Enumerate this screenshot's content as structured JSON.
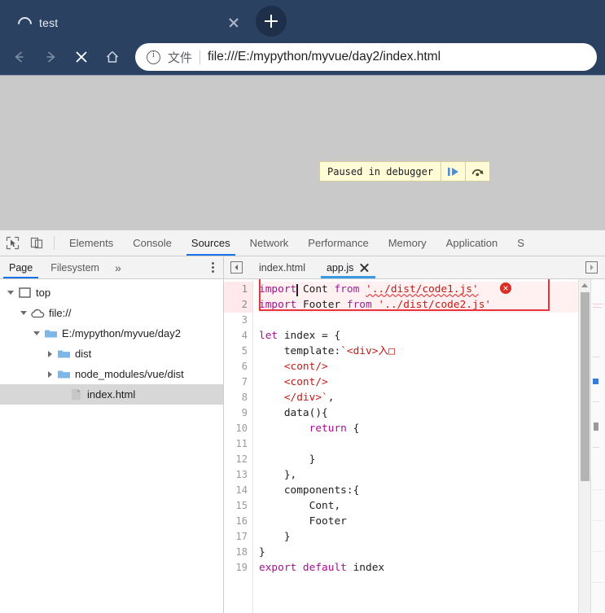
{
  "browser": {
    "tab": {
      "title": "test",
      "favicon": "loading-spinner-icon",
      "close_icon": "close-icon"
    },
    "new_tab_icon": "plus-icon",
    "nav": {
      "back_icon": "arrow-left-icon",
      "forward_icon": "arrow-right-icon",
      "stop_icon": "close-icon",
      "home_icon": "home-icon"
    },
    "omnibox": {
      "info_icon": "info-circle-icon",
      "scheme_label": "文件",
      "url": "file:///E:/mypython/myvue/day2/index.html"
    },
    "chrome_color": "#2b4162"
  },
  "viewport": {
    "background": "#c9c9c9",
    "paused_banner": {
      "label": "Paused in debugger",
      "resume_icon": "resume-script-icon",
      "step_over_icon": "step-over-icon",
      "background": "#fffbd7",
      "border": "#d4cf9a"
    }
  },
  "devtools": {
    "left_icons": [
      {
        "name": "inspect-element-icon"
      },
      {
        "name": "device-toolbar-icon"
      }
    ],
    "tabs": [
      {
        "label": "Elements",
        "active": false
      },
      {
        "label": "Console",
        "active": false
      },
      {
        "label": "Sources",
        "active": true
      },
      {
        "label": "Network",
        "active": false
      },
      {
        "label": "Performance",
        "active": false
      },
      {
        "label": "Memory",
        "active": false
      },
      {
        "label": "Application",
        "active": false
      },
      {
        "label": "S",
        "active": false
      }
    ],
    "active_tab_accent": "#1a73e8",
    "navigator": {
      "tabs": [
        {
          "label": "Page",
          "active": true
        },
        {
          "label": "Filesystem",
          "active": false
        }
      ],
      "more_tabs_icon": "chevron-double-right-icon",
      "more_options_icon": "kebab-menu-icon",
      "tree": [
        {
          "depth": 0,
          "twisty": "expanded",
          "icon": "frame-icon",
          "label": "top",
          "selected": false
        },
        {
          "depth": 1,
          "twisty": "expanded",
          "icon": "cloud-icon",
          "label": "file://",
          "selected": false
        },
        {
          "depth": 2,
          "twisty": "expanded",
          "icon": "folder-icon",
          "label": "E:/mypython/myvue/day2",
          "selected": false
        },
        {
          "depth": 3,
          "twisty": "collapsed",
          "icon": "folder-icon",
          "label": "dist",
          "selected": false
        },
        {
          "depth": 3,
          "twisty": "collapsed",
          "icon": "folder-icon",
          "label": "node_modules/vue/dist",
          "selected": false
        },
        {
          "depth": 3,
          "twisty": "none",
          "icon": "file-icon",
          "label": "index.html",
          "selected": true
        }
      ]
    },
    "editor": {
      "back_icon": "panel-collapse-icon",
      "forward_icon": "panel-expand-icon",
      "tabs": [
        {
          "label": "index.html",
          "active": false,
          "closable": false
        },
        {
          "label": "app.js",
          "active": true,
          "closable": true
        }
      ],
      "active_tab_accent": "#3a9ae0",
      "close_icon": "close-icon",
      "error_badge_icon": "error-circle-icon",
      "annotation_box_color": "#e8343c",
      "scrollbar": {
        "up_arrow_icon": "scroll-up-arrow-icon"
      },
      "code": {
        "file": "app.js",
        "lines": [
          {
            "n": 1,
            "text": "import Cont from '../dist/code1.js'"
          },
          {
            "n": 2,
            "text": "import Footer from '../dist/code2.js'"
          },
          {
            "n": 3,
            "text": ""
          },
          {
            "n": 4,
            "text": "let index = {"
          },
          {
            "n": 5,
            "text": "    template:`<div>入口"
          },
          {
            "n": 6,
            "text": "    <cont/>"
          },
          {
            "n": 7,
            "text": "    <cont/>"
          },
          {
            "n": 8,
            "text": "    </div>`,"
          },
          {
            "n": 9,
            "text": "    data(){"
          },
          {
            "n": 10,
            "text": "        return {"
          },
          {
            "n": 11,
            "text": ""
          },
          {
            "n": 12,
            "text": "        }"
          },
          {
            "n": 13,
            "text": "    },"
          },
          {
            "n": 14,
            "text": "    components:{"
          },
          {
            "n": 15,
            "text": "        Cont,"
          },
          {
            "n": 16,
            "text": "        Footer"
          },
          {
            "n": 17,
            "text": "    }"
          },
          {
            "n": 18,
            "text": "}"
          },
          {
            "n": 19,
            "text": "export default index"
          }
        ]
      }
    }
  }
}
